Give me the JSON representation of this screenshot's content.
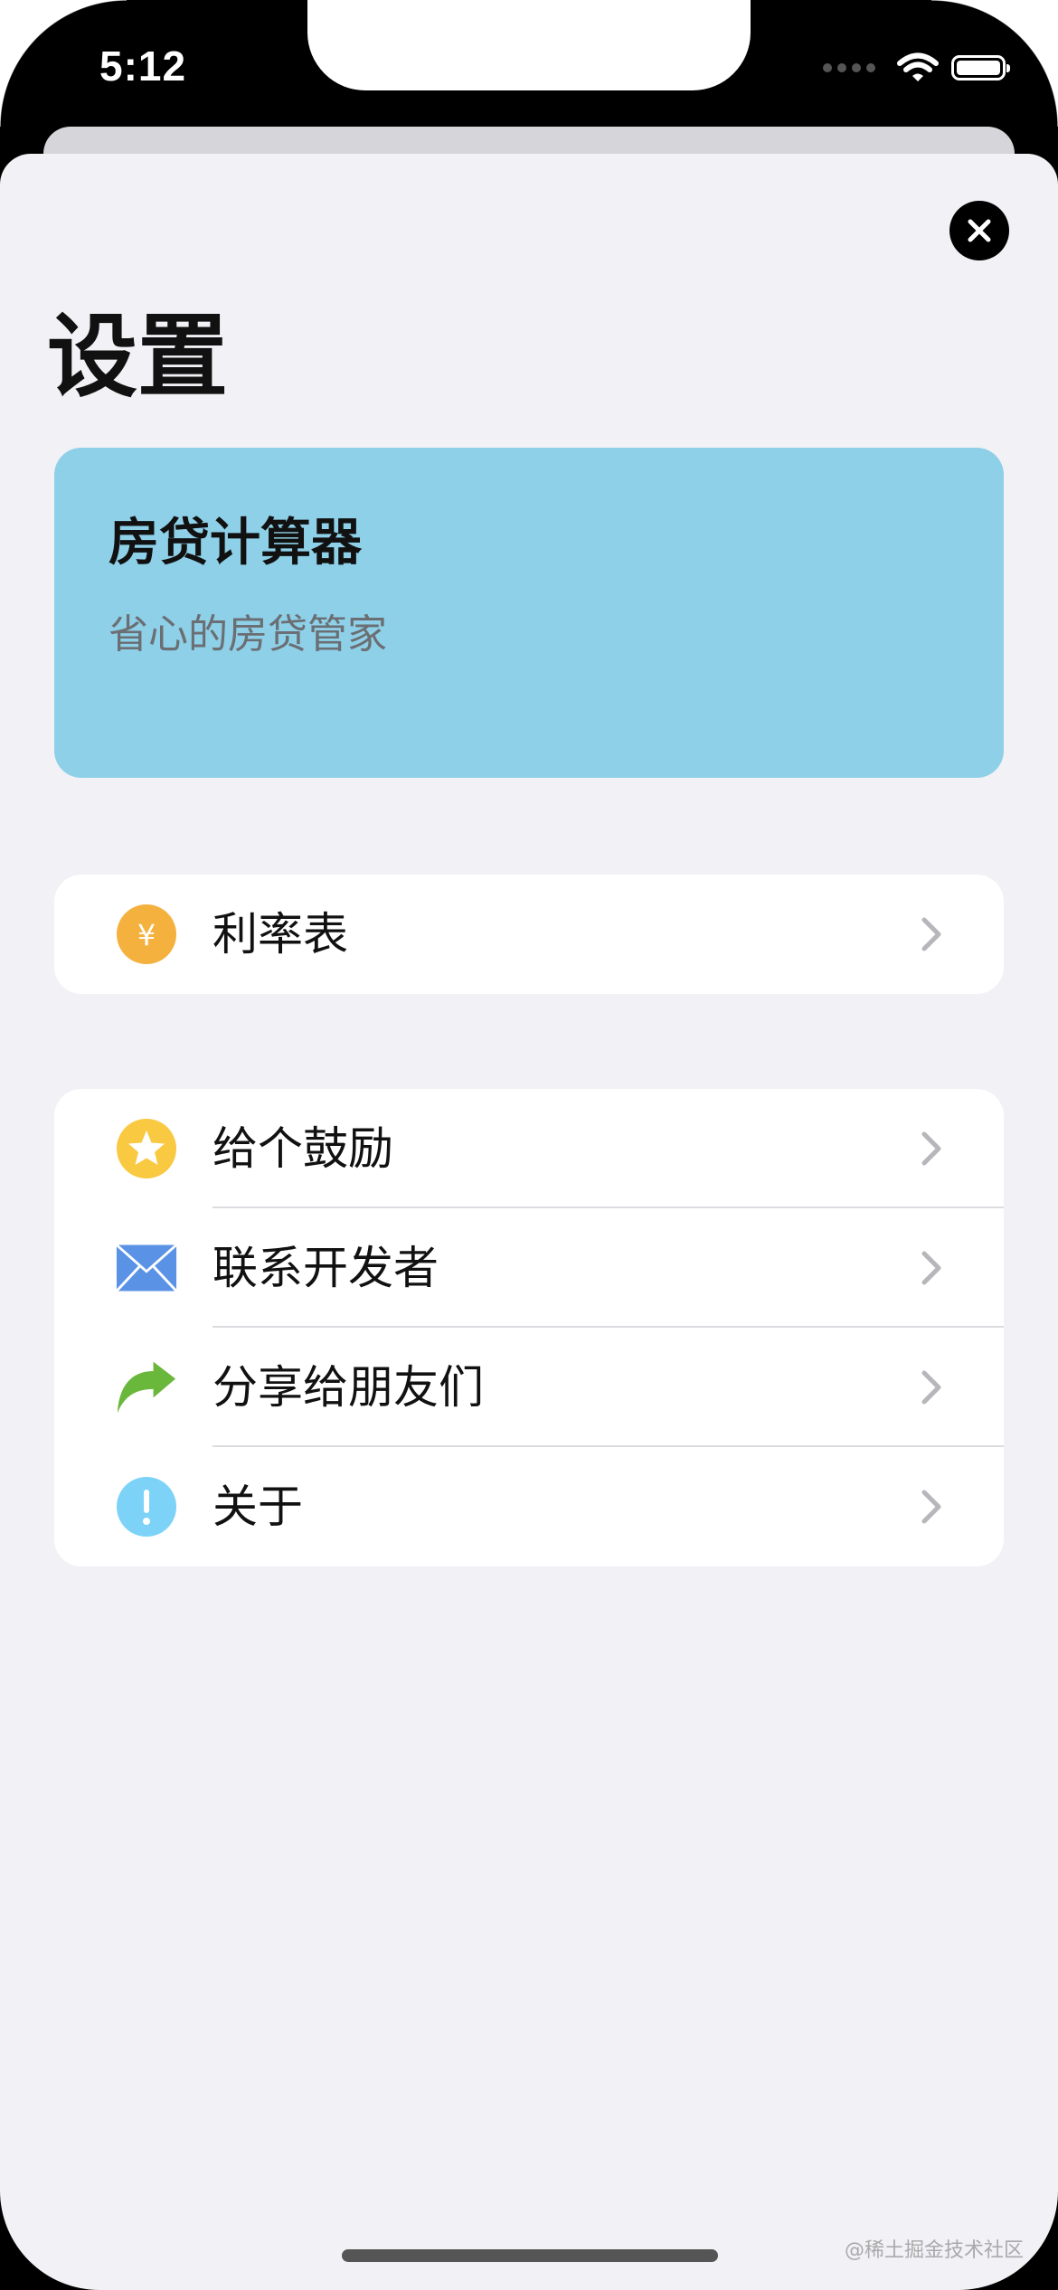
{
  "status_bar": {
    "time": "5:12",
    "icons": [
      "signal-dots-icon",
      "wifi-icon",
      "battery-icon"
    ]
  },
  "header": {
    "close_icon": "close-icon",
    "title": "设置"
  },
  "banner": {
    "title": "房贷计算器",
    "subtitle": "省心的房贷管家",
    "color": "#8dd0e8"
  },
  "groups": [
    {
      "items": [
        {
          "label": "利率表",
          "icon": "yen-icon",
          "icon_color": "#f4b13e"
        }
      ]
    },
    {
      "items": [
        {
          "label": "给个鼓励",
          "icon": "star-icon",
          "icon_color": "#f9c942"
        },
        {
          "label": "联系开发者",
          "icon": "mail-icon",
          "icon_color": "#5a93e6"
        },
        {
          "label": "分享给朋友们",
          "icon": "share-arrow-icon",
          "icon_color": "#69b83c"
        },
        {
          "label": "关于",
          "icon": "info-icon",
          "icon_color": "#7dd2f7"
        }
      ]
    }
  ],
  "watermark": "@稀土掘金技术社区"
}
